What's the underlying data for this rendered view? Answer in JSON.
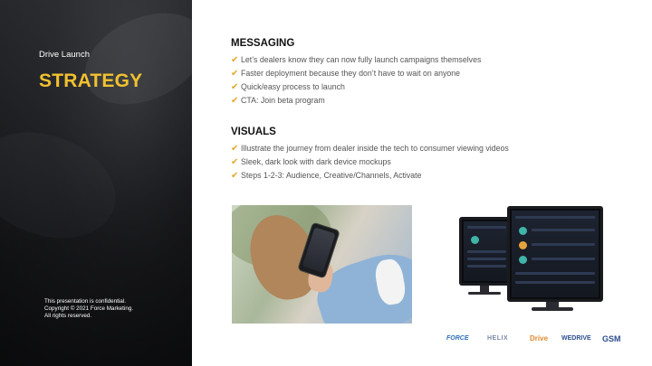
{
  "sidebar": {
    "eyebrow": "Drive Launch",
    "title": "STRATEGY",
    "legal": [
      "This presentation is confidential.",
      "Copyright © 2021 Force Marketing.",
      "All rights reserved."
    ]
  },
  "sections": [
    {
      "heading": "MESSAGING",
      "bullets": [
        "Let’s dealers know they can now fully launch campaigns themselves",
        "Faster deployment because they don’t have to wait on anyone",
        "Quick/easy process to launch",
        "CTA: Join beta program"
      ]
    },
    {
      "heading": "VISUALS",
      "bullets": [
        "Illustrate the journey from dealer inside the tech to consumer viewing videos",
        "Sleek, dark look with dark device mockups",
        "Steps 1-2-3: Audience, Creative/Channels, Activate"
      ]
    }
  ],
  "bullet_icon": "✔",
  "logos": [
    "FORCE",
    "HELIX",
    "Drive",
    "WEDRIVE",
    "GSM"
  ],
  "colors": {
    "accent": "#f2c12e",
    "check": "#e3a82b",
    "sidebar_bg": "#1c1d20"
  }
}
